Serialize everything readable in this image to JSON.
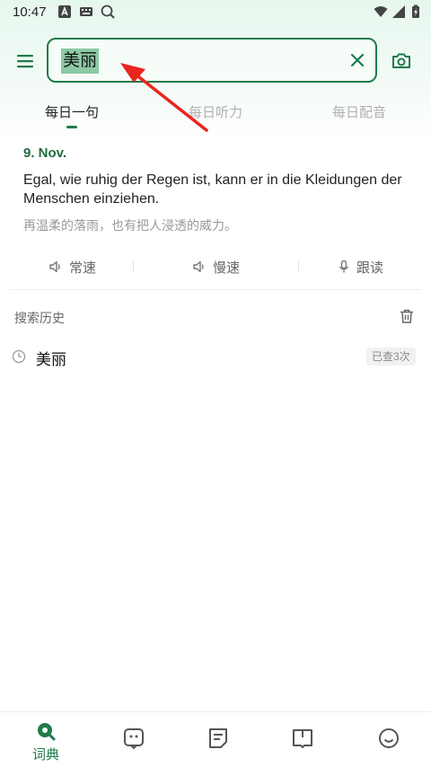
{
  "status_bar": {
    "time": "10:47"
  },
  "header": {
    "menu_icon": "menu-icon",
    "search": {
      "value": "美丽"
    },
    "clear_icon": "close-icon",
    "camera_icon": "camera-icon"
  },
  "tabs": [
    {
      "label": "每日一句",
      "active": true
    },
    {
      "label": "每日听力",
      "active": false
    },
    {
      "label": "每日配音",
      "active": false
    }
  ],
  "daily": {
    "date": "9. Nov.",
    "sentence": "Egal, wie ruhig der Regen ist, kann er in die Kleidungen der Menschen einziehen.",
    "translation": "再温柔的落雨，也有把人浸透的威力。",
    "audio_buttons": [
      {
        "label": "常速",
        "icon": "speaker-icon"
      },
      {
        "label": "慢速",
        "icon": "speaker-icon"
      },
      {
        "label": "跟读",
        "icon": "microphone-icon"
      }
    ]
  },
  "history": {
    "title": "搜索历史",
    "items": [
      {
        "word": "美丽",
        "badge": "已查3次"
      }
    ]
  },
  "bottom_nav": {
    "items": [
      {
        "label": "词典",
        "icon": "dictionary-icon",
        "active": true
      },
      {
        "label": "",
        "icon": "chat-icon",
        "active": false
      },
      {
        "label": "",
        "icon": "notes-icon",
        "active": false
      },
      {
        "label": "",
        "icon": "book-icon",
        "active": false
      },
      {
        "label": "",
        "icon": "smiley-icon",
        "active": false
      }
    ]
  },
  "colors": {
    "accent": "#1f7a4a",
    "selection": "#8cc9a5",
    "annotation_arrow": "#e8261d"
  }
}
